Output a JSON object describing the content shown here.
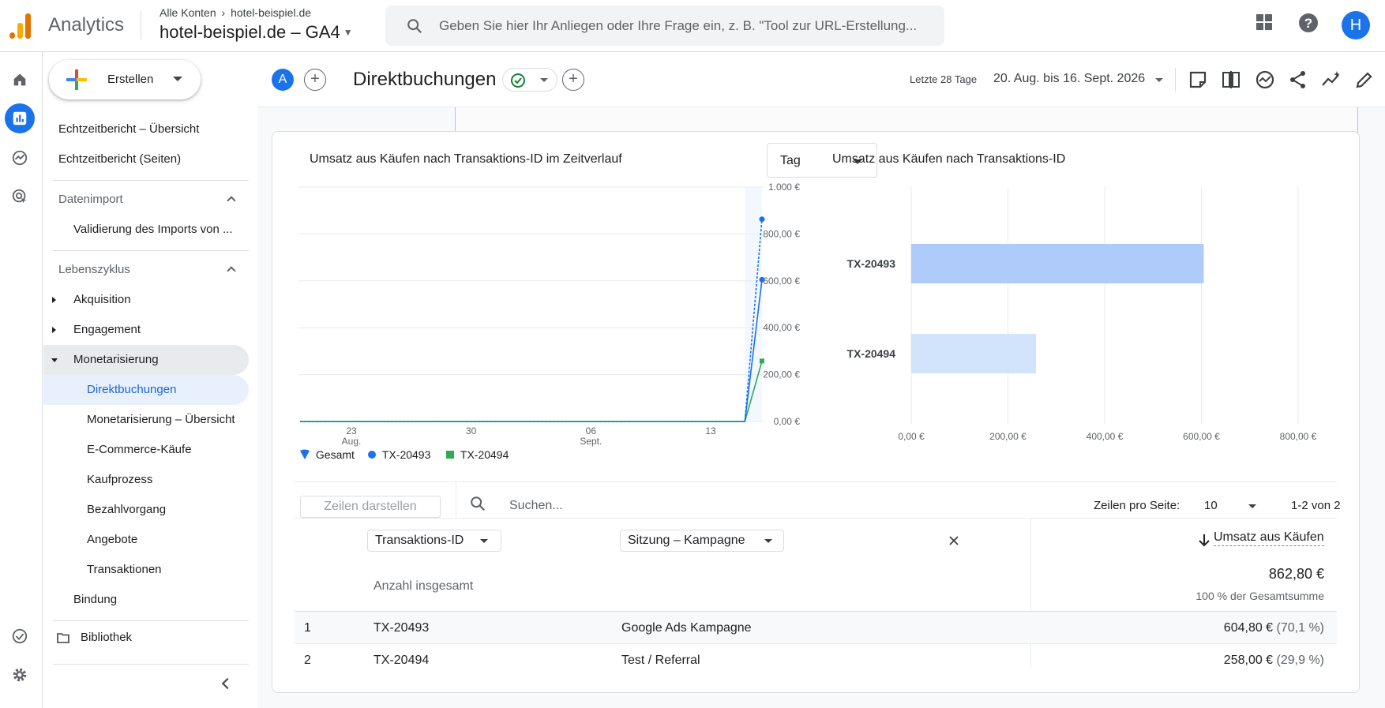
{
  "app": {
    "name": "Analytics",
    "breadcrumb_account": "Alle Konten",
    "breadcrumb_separator": "›",
    "breadcrumb_property": "hotel-beispiel.de",
    "property_title": "hotel-beispiel.de – GA4",
    "avatar_letter": "H"
  },
  "search": {
    "placeholder": "Geben Sie hier Ihr Anliegen oder Ihre Frage ein, z. B. \"Tool zur URL-Erstellung..."
  },
  "nav": {
    "create_label": "Erstellen",
    "items": [
      {
        "label": "Echtzeitbericht – Übersicht"
      },
      {
        "label": "Echtzeitbericht (Seiten)"
      },
      {
        "label": "Datenimport"
      },
      {
        "label": "Validierung des Imports von ..."
      },
      {
        "label": "Lebenszyklus"
      },
      {
        "label": "Akquisition"
      },
      {
        "label": "Engagement"
      },
      {
        "label": "Monetarisierung"
      },
      {
        "label": "Direktbuchungen"
      },
      {
        "label": "Monetarisierung – Übersicht"
      },
      {
        "label": "E-Commerce-Käufe"
      },
      {
        "label": "Kaufprozess"
      },
      {
        "label": "Bezahlvorgang"
      },
      {
        "label": "Angebote"
      },
      {
        "label": "Transaktionen"
      },
      {
        "label": "Bindung"
      },
      {
        "label": "Bibliothek"
      }
    ]
  },
  "header": {
    "comparison_badge": "A",
    "report_title": "Direktbuchungen",
    "date_label": "Letzte 28 Tage",
    "date_range": "20. Aug. bis 16. Sept. 2026"
  },
  "colors": {
    "accent": "#1a73e8",
    "series_total": "#1a73e8",
    "series_tx20493": "#1a73e8",
    "series_tx20494": "#34a853",
    "bar_tx20493": "#aecbfa",
    "bar_tx20494": "#d2e3fc"
  },
  "chart_left": {
    "title": "Umsatz aus Käufen nach Transaktions-ID im Zeitverlauf",
    "granularity": "Tag",
    "legend": [
      "Gesamt",
      "TX-20493",
      "TX-20494"
    ],
    "x_ticks": [
      {
        "day": "23",
        "month": "Aug."
      },
      {
        "day": "30",
        "month": ""
      },
      {
        "day": "06",
        "month": "Sept."
      },
      {
        "day": "13",
        "month": ""
      }
    ],
    "y_ticks": [
      "1.000 €",
      "800,00 €",
      "600,00 €",
      "400,00 €",
      "200,00 €",
      "0,00 €"
    ]
  },
  "chart_right": {
    "title": "Umsatz aus Käufen nach Transaktions-ID",
    "x_ticks": [
      "0,00 €",
      "200,00 €",
      "400,00 €",
      "600,00 €",
      "800,00 €"
    ]
  },
  "chart_data": [
    {
      "type": "line",
      "title": "Umsatz aus Käufen nach Transaktions-ID im Zeitverlauf",
      "x": [
        "20. Aug.",
        "21. Aug.",
        "22. Aug.",
        "23. Aug.",
        "24. Aug.",
        "25. Aug.",
        "26. Aug.",
        "27. Aug.",
        "28. Aug.",
        "29. Aug.",
        "30. Aug.",
        "31. Aug.",
        "1. Sept.",
        "2. Sept.",
        "3. Sept.",
        "4. Sept.",
        "5. Sept.",
        "6. Sept.",
        "7. Sept.",
        "8. Sept.",
        "9. Sept.",
        "10. Sept.",
        "11. Sept.",
        "12. Sept.",
        "13. Sept.",
        "14. Sept.",
        "15. Sept.",
        "16. Sept."
      ],
      "series": [
        {
          "name": "Gesamt",
          "values": [
            0,
            0,
            0,
            0,
            0,
            0,
            0,
            0,
            0,
            0,
            0,
            0,
            0,
            0,
            0,
            0,
            0,
            0,
            0,
            0,
            0,
            0,
            0,
            0,
            0,
            0,
            0,
            862.8
          ]
        },
        {
          "name": "TX-20493",
          "values": [
            0,
            0,
            0,
            0,
            0,
            0,
            0,
            0,
            0,
            0,
            0,
            0,
            0,
            0,
            0,
            0,
            0,
            0,
            0,
            0,
            0,
            0,
            0,
            0,
            0,
            0,
            0,
            604.8
          ]
        },
        {
          "name": "TX-20494",
          "values": [
            0,
            0,
            0,
            0,
            0,
            0,
            0,
            0,
            0,
            0,
            0,
            0,
            0,
            0,
            0,
            0,
            0,
            0,
            0,
            0,
            0,
            0,
            0,
            0,
            0,
            0,
            0,
            258
          ]
        }
      ],
      "ylim": [
        0,
        1000
      ],
      "grid": true,
      "legend": "bottom-left"
    },
    {
      "type": "bar",
      "orientation": "horizontal",
      "title": "Umsatz aus Käufen nach Transaktions-ID",
      "categories": [
        "TX-20493",
        "TX-20494"
      ],
      "values": [
        604.8,
        258
      ],
      "xlim": [
        0,
        800
      ],
      "grid": true
    }
  ],
  "table": {
    "rows_button": "Zeilen darstellen",
    "search_placeholder": "Suchen...",
    "rows_per_page_label": "Zeilen pro Seite:",
    "rows_per_page_value": "10",
    "page_info": "1-2 von 2",
    "dimension_1": "Transaktions-ID",
    "dimension_2": "Sitzung – Kampagne",
    "metric": "Umsatz aus Käufen",
    "total_label": "Anzahl insgesamt",
    "total_value": "862,80 €",
    "total_pct": "100 % der Gesamtsumme",
    "rows": [
      {
        "idx": "1",
        "id": "TX-20493",
        "campaign": "Google Ads Kampagne",
        "value": "604,80 €",
        "pct": "(70,1 %)"
      },
      {
        "idx": "2",
        "id": "TX-20494",
        "campaign": "Test / Referral",
        "value": "258,00 €",
        "pct": "(29,9 %)"
      }
    ]
  }
}
